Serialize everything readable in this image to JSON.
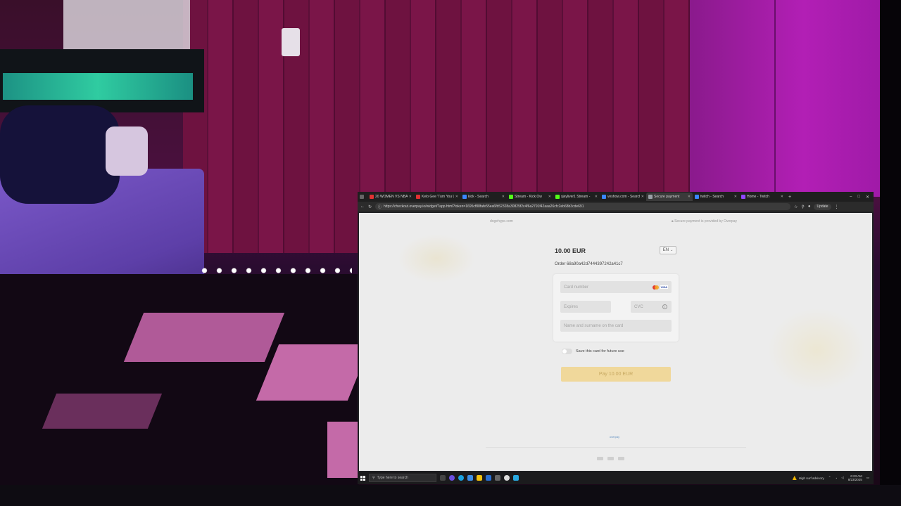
{
  "browser": {
    "tabs": [
      {
        "label": "20 WOMEN VS NBA",
        "color": "#e03232",
        "active": false
      },
      {
        "label": "Kelo Gee 'Turn You Up",
        "color": "#e03232",
        "active": false
      },
      {
        "label": "kick - Search",
        "color": "#3a86ff",
        "active": false
      },
      {
        "label": "Stream - Kick.Ow",
        "color": "#53fc18",
        "active": false
      },
      {
        "label": "sjeyliver1 Stream -",
        "color": "#53fc18",
        "active": false
      },
      {
        "label": "veshow.com - Search",
        "color": "#3a86ff",
        "active": false
      },
      {
        "label": "Secure payment",
        "color": "#9aa0a6",
        "active": true
      },
      {
        "label": "twitch - Search",
        "color": "#3a86ff",
        "active": false
      },
      {
        "label": "Home - Twitch",
        "color": "#9146ff",
        "active": false
      }
    ],
    "url": "https://checkout.overpay.io/widget/?app.html?token=1695cf88fafe55ea6fb52328a30825f2c4f6a2791f42aaa26cfc2eb68b3cde691",
    "update_label": "Update"
  },
  "page": {
    "site": "dogehype.com",
    "secure_label": "Secure payment is provided by Overpay",
    "amount": "10.00 EUR",
    "language": "EN",
    "order": "Order 68a90a42d7444397242a41c7",
    "card_number_placeholder": "Card number",
    "expires_placeholder": "Expires",
    "cvc_placeholder": "CVC",
    "name_placeholder": "Name and surname on the card",
    "card_brand_visa": "VISA",
    "save_card_label": "Save this card for future use",
    "pay_button": "Pay 10.00 EUR",
    "footer_logo": "overpay"
  },
  "taskbar": {
    "search_placeholder": "Type here to search",
    "weather": "High surf advisory",
    "time": "6:23 AM",
    "date": "8/23/2025"
  },
  "colors": {
    "pay_button_bg": "#f0d89b",
    "page_bg": "#ececec"
  }
}
